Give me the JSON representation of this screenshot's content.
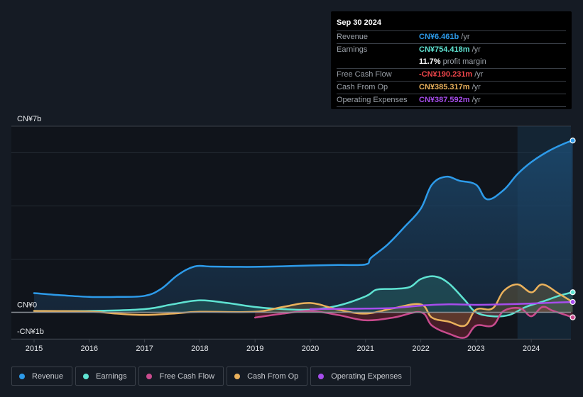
{
  "tooltip": {
    "date": "Sep 30 2024",
    "rows": [
      {
        "label": "Revenue",
        "value": "CN¥6.461b",
        "unit": "/yr",
        "color": "#2d9bea"
      },
      {
        "label": "Earnings",
        "value": "CN¥754.418m",
        "unit": "/yr",
        "color": "#5fe3d2"
      },
      {
        "label": "",
        "value": "11.7%",
        "unit": "profit margin",
        "color": "#ffffff"
      },
      {
        "label": "Free Cash Flow",
        "value": "-CN¥190.231m",
        "unit": "/yr",
        "color": "#f0464b"
      },
      {
        "label": "Cash From Op",
        "value": "CN¥385.317m",
        "unit": "/yr",
        "color": "#eab15c"
      },
      {
        "label": "Operating Expenses",
        "value": "CN¥387.592m",
        "unit": "/yr",
        "color": "#a74ded"
      }
    ]
  },
  "legend": [
    {
      "label": "Revenue",
      "color": "#2d9bea"
    },
    {
      "label": "Earnings",
      "color": "#5fe3d2"
    },
    {
      "label": "Free Cash Flow",
      "color": "#c94b8e"
    },
    {
      "label": "Cash From Op",
      "color": "#eab15c"
    },
    {
      "label": "Operating Expenses",
      "color": "#a74ded"
    }
  ],
  "chart_data": {
    "type": "line",
    "title": "",
    "xlabel": "",
    "ylabel": "",
    "currency_unit": "CN¥ billions",
    "ylim": [
      -1,
      7
    ],
    "xlim": [
      2014.9,
      2024.75
    ],
    "y_tick_labels": [
      {
        "value": 7,
        "label": "CN¥7b"
      },
      {
        "value": 0,
        "label": "CN¥0"
      },
      {
        "value": -1,
        "label": "-CN¥1b"
      }
    ],
    "gridlines": [
      7,
      6,
      4,
      2,
      0,
      -1
    ],
    "x_ticks": [
      2015,
      2016,
      2017,
      2018,
      2019,
      2020,
      2021,
      2022,
      2023,
      2024
    ],
    "x_tick_labels": [
      "2015",
      "2016",
      "2017",
      "2018",
      "2019",
      "2020",
      "2021",
      "2022",
      "2023",
      "2024"
    ],
    "highlight_range": [
      2023.75,
      2024.75
    ],
    "series": [
      {
        "name": "Revenue",
        "color": "#2d9bea",
        "fill": true,
        "x": [
          2015,
          2015.5,
          2016,
          2016.5,
          2017,
          2017.3,
          2017.6,
          2017.9,
          2018.2,
          2018.6,
          2019,
          2019.5,
          2020,
          2020.5,
          2021,
          2021.1,
          2021.4,
          2021.7,
          2022,
          2022.2,
          2022.45,
          2022.7,
          2023,
          2023.2,
          2023.5,
          2023.75,
          2024,
          2024.3,
          2024.6,
          2024.75
        ],
        "values": [
          0.72,
          0.64,
          0.58,
          0.58,
          0.62,
          0.88,
          1.4,
          1.72,
          1.72,
          1.71,
          1.71,
          1.73,
          1.76,
          1.78,
          1.8,
          2.05,
          2.55,
          3.2,
          3.9,
          4.8,
          5.1,
          4.95,
          4.8,
          4.25,
          4.6,
          5.2,
          5.65,
          6.05,
          6.35,
          6.461
        ]
      },
      {
        "name": "Earnings",
        "color": "#5fe3d2",
        "fill": true,
        "x": [
          2015,
          2016,
          2017,
          2017.5,
          2018,
          2018.5,
          2019,
          2019.5,
          2020,
          2020.5,
          2021,
          2021.2,
          2021.5,
          2021.8,
          2022,
          2022.25,
          2022.5,
          2022.8,
          2023,
          2023.3,
          2023.6,
          2023.9,
          2024.2,
          2024.5,
          2024.75
        ],
        "values": [
          0.05,
          0.05,
          0.12,
          0.3,
          0.45,
          0.35,
          0.2,
          0.12,
          0.1,
          0.25,
          0.6,
          0.85,
          0.88,
          0.95,
          1.25,
          1.35,
          1.1,
          0.45,
          0.0,
          -0.15,
          -0.1,
          0.2,
          0.4,
          0.62,
          0.754
        ]
      },
      {
        "name": "Free Cash Flow",
        "color": "#c94b8e",
        "fill": true,
        "x": [
          2019,
          2019.5,
          2020,
          2020.5,
          2021,
          2021.5,
          2022,
          2022.2,
          2022.5,
          2022.8,
          2023,
          2023.3,
          2023.5,
          2023.8,
          2024,
          2024.2,
          2024.4,
          2024.75
        ],
        "values": [
          -0.2,
          -0.05,
          0.05,
          -0.1,
          -0.3,
          -0.2,
          0.0,
          -0.5,
          -0.8,
          -0.95,
          -0.5,
          -0.5,
          0.05,
          0.15,
          -0.15,
          0.2,
          0.05,
          -0.19
        ]
      },
      {
        "name": "Cash From Op",
        "color": "#eab15c",
        "fill": true,
        "x": [
          2015,
          2016,
          2016.5,
          2017,
          2017.5,
          2018,
          2019,
          2019.5,
          2020,
          2020.5,
          2021,
          2021.5,
          2022,
          2022.2,
          2022.5,
          2022.8,
          2023,
          2023.3,
          2023.5,
          2023.75,
          2024,
          2024.2,
          2024.5,
          2024.75
        ],
        "values": [
          0.05,
          0.03,
          -0.05,
          -0.1,
          -0.05,
          0.02,
          0.02,
          0.2,
          0.35,
          0.1,
          -0.05,
          0.15,
          0.3,
          -0.2,
          -0.35,
          -0.5,
          0.1,
          0.15,
          0.8,
          1.05,
          0.75,
          1.05,
          0.7,
          0.385
        ]
      },
      {
        "name": "Operating Expenses",
        "color": "#a74ded",
        "fill": false,
        "x": [
          2020,
          2020.5,
          2021,
          2021.5,
          2022,
          2022.5,
          2023,
          2023.5,
          2024,
          2024.5,
          2024.75
        ],
        "values": [
          0.12,
          0.13,
          0.14,
          0.16,
          0.25,
          0.3,
          0.28,
          0.3,
          0.33,
          0.37,
          0.388
        ]
      }
    ]
  }
}
